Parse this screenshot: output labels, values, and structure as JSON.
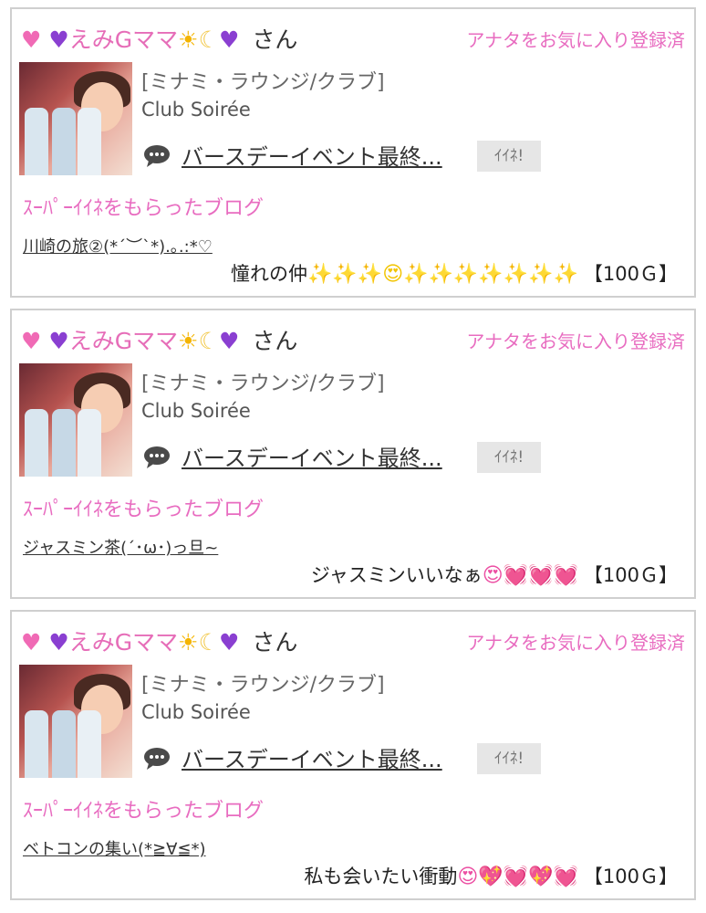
{
  "cards": [
    {
      "nickname": "えみGママ",
      "san": "さん",
      "favorite_status": "アナタをお気に入り登録済",
      "shop": "[ミナミ・ラウンジ/クラブ]",
      "club": "Club Soirée",
      "event_link": "バースデーイベント最終...",
      "iine": "ｲｲﾈ!",
      "super_label": "ｽｰﾊﾟｰｲｲﾈをもらったブログ",
      "blog_title": "川崎の旅②(*´︶`*).｡.:*♡",
      "comment_text": "憧れの仲",
      "comment_emojis": "✨✨✨😍✨✨✨✨✨✨✨",
      "price": "【100Ｇ】"
    },
    {
      "nickname": "えみGママ",
      "san": "さん",
      "favorite_status": "アナタをお気に入り登録済",
      "shop": "[ミナミ・ラウンジ/クラブ]",
      "club": "Club Soirée",
      "event_link": "バースデーイベント最終...",
      "iine": "ｲｲﾈ!",
      "super_label": "ｽｰﾊﾟｰｲｲﾈをもらったブログ",
      "blog_title": "ジャスミン茶(´･ω･)っ旦~",
      "comment_text": "ジャスミンいいなぁ",
      "comment_emojis": "😍💓💓💓",
      "price": "【100Ｇ】"
    },
    {
      "nickname": "えみGママ",
      "san": "さん",
      "favorite_status": "アナタをお気に入り登録済",
      "shop": "[ミナミ・ラウンジ/クラブ]",
      "club": "Club Soirée",
      "event_link": "バースデーイベント最終...",
      "iine": "ｲｲﾈ!",
      "super_label": "ｽｰﾊﾟｰｲｲﾈをもらったブログ",
      "blog_title": "ベトコンの集い(*≧∀≦*)",
      "comment_text": "私も会いたい衝動",
      "comment_emojis": "😍💖💓💖💓",
      "price": "【100Ｇ】"
    }
  ],
  "icons": {
    "nick_prefix": [
      "pink-heart-icon",
      "purple-heart-icon"
    ],
    "nick_suffix": [
      "sun-icon",
      "crescent-moon-icon",
      "purple-heart-icon"
    ],
    "event": "speech-bubble-icon"
  },
  "colors": {
    "accent_pink": "#e86cc0",
    "border": "#cfcfcf",
    "button_bg": "#e6e6e6"
  }
}
